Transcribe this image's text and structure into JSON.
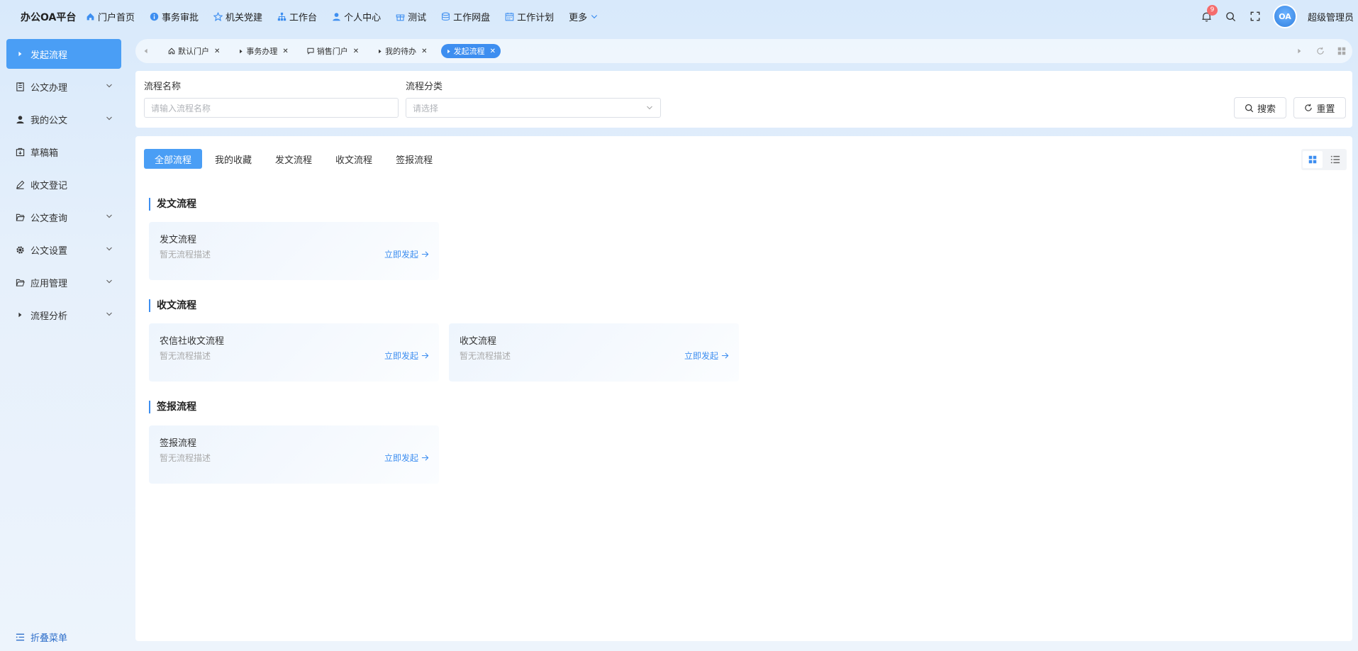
{
  "brand": "办公OA平台",
  "topnav": [
    {
      "label": "门户首页",
      "icon": "home-icon"
    },
    {
      "label": "事务审批",
      "icon": "info-icon"
    },
    {
      "label": "机关党建",
      "icon": "star-icon"
    },
    {
      "label": "工作台",
      "icon": "sitemap-icon"
    },
    {
      "label": "个人中心",
      "icon": "user-icon"
    },
    {
      "label": "测试",
      "icon": "gift-icon"
    },
    {
      "label": "工作网盘",
      "icon": "database-icon"
    },
    {
      "label": "工作计划",
      "icon": "calendar-icon"
    },
    {
      "label": "更多",
      "icon": "chevron-down-icon"
    }
  ],
  "header": {
    "notification_count": "9",
    "avatar_text": "OA",
    "username": "超级管理员"
  },
  "sidebar": {
    "items": [
      {
        "label": "发起流程",
        "active": true,
        "has_children": false
      },
      {
        "label": "公文办理",
        "active": false,
        "has_children": true
      },
      {
        "label": "我的公文",
        "active": false,
        "has_children": true
      },
      {
        "label": "草稿箱",
        "active": false,
        "has_children": false
      },
      {
        "label": "收文登记",
        "active": false,
        "has_children": false
      },
      {
        "label": "公文查询",
        "active": false,
        "has_children": true
      },
      {
        "label": "公文设置",
        "active": false,
        "has_children": true
      },
      {
        "label": "应用管理",
        "active": false,
        "has_children": true
      },
      {
        "label": "流程分析",
        "active": false,
        "has_children": true
      }
    ],
    "collapse_label": "折叠菜单"
  },
  "tabs": [
    {
      "label": "默认门户",
      "active": false
    },
    {
      "label": "事务办理",
      "active": false
    },
    {
      "label": "销售门户",
      "active": false
    },
    {
      "label": "我的待办",
      "active": false
    },
    {
      "label": "发起流程",
      "active": true
    }
  ],
  "search": {
    "name_label": "流程名称",
    "name_placeholder": "请输入流程名称",
    "category_label": "流程分类",
    "category_placeholder": "请选择",
    "search_button": "搜索",
    "reset_button": "重置"
  },
  "category_tabs": [
    "全部流程",
    "我的收藏",
    "发文流程",
    "收文流程",
    "签报流程"
  ],
  "sections": [
    {
      "title": "发文流程",
      "cards": [
        {
          "title": "发文流程",
          "desc": "暂无流程描述",
          "link": "立即发起"
        }
      ]
    },
    {
      "title": "收文流程",
      "cards": [
        {
          "title": "农信社收文流程",
          "desc": "暂无流程描述",
          "link": "立即发起"
        },
        {
          "title": "收文流程",
          "desc": "暂无流程描述",
          "link": "立即发起"
        }
      ]
    },
    {
      "title": "签报流程",
      "cards": [
        {
          "title": "签报流程",
          "desc": "暂无流程描述",
          "link": "立即发起"
        }
      ]
    }
  ],
  "colors": {
    "accent": "#4a9ef5",
    "link": "#3d8ef0",
    "badge": "#f56c6c"
  }
}
